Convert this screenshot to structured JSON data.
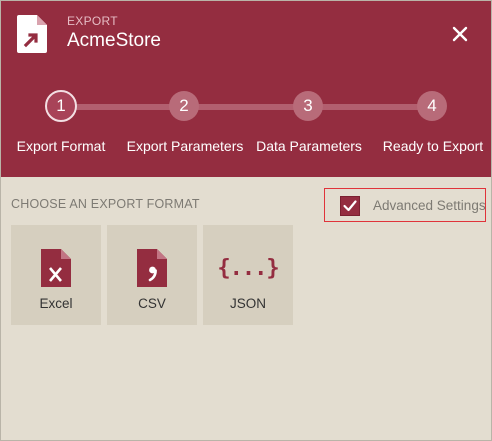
{
  "header": {
    "export_label": "EXPORT",
    "app_title": "AcmeStore",
    "app_icon": "export-document-icon",
    "close_icon": "close-icon"
  },
  "steps": [
    {
      "number": "1",
      "label": "Export Format",
      "active": true
    },
    {
      "number": "2",
      "label": "Export Parameters",
      "active": false
    },
    {
      "number": "3",
      "label": "Data Parameters",
      "active": false
    },
    {
      "number": "4",
      "label": "Ready to Export",
      "active": false
    }
  ],
  "content": {
    "section_title": "CHOOSE AN EXPORT FORMAT",
    "advanced_settings": {
      "label": "Advanced Settings",
      "checked": true
    },
    "formats": [
      {
        "label": "Excel",
        "icon": "excel-file-icon"
      },
      {
        "label": "CSV",
        "icon": "csv-file-icon"
      },
      {
        "label": "JSON",
        "icon": "json-braces-icon",
        "icon_text": "{...}"
      }
    ]
  },
  "colors": {
    "accent": "#942d40",
    "background": "#e3ddd0",
    "tile": "#d6cfbf",
    "highlight_border": "#e0333a"
  }
}
